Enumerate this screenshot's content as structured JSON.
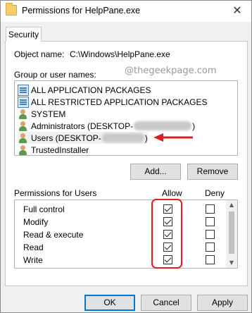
{
  "window": {
    "title": "Permissions for HelpPane.exe",
    "close_glyph": "✕",
    "folder_icon": "folder-icon"
  },
  "tabs": [
    {
      "label": "Security"
    }
  ],
  "object": {
    "label": "Object name:",
    "value": "C:\\Windows\\HelpPane.exe"
  },
  "groups": {
    "label": "Group or user names:",
    "watermark": "@thegeekpage.com",
    "items": [
      {
        "icon": "app-package-icon",
        "prefix": "ALL APPLICATION PACKAGES",
        "suffix": ""
      },
      {
        "icon": "app-package-icon",
        "prefix": "ALL RESTRICTED APPLICATION PACKAGES",
        "suffix": ""
      },
      {
        "icon": "users-icon",
        "prefix": "SYSTEM",
        "suffix": ""
      },
      {
        "icon": "users-icon",
        "prefix": "Administrators (DESKTOP-",
        "suffix": ")"
      },
      {
        "icon": "users-icon",
        "prefix": "Users (DESKTOP-",
        "suffix": ")"
      },
      {
        "icon": "users-icon",
        "prefix": "TrustedInstaller",
        "suffix": ""
      }
    ],
    "selected_index": 4,
    "annotation_arrow_color": "#e02020"
  },
  "buttons": {
    "add": "Add...",
    "remove": "Remove",
    "ok": "OK",
    "cancel": "Cancel",
    "apply": "Apply"
  },
  "permissions": {
    "label": "Permissions for Users",
    "allow_header": "Allow",
    "deny_header": "Deny",
    "rows": [
      {
        "name": "Full control",
        "allow": true,
        "deny": false
      },
      {
        "name": "Modify",
        "allow": true,
        "deny": false
      },
      {
        "name": "Read & execute",
        "allow": true,
        "deny": false
      },
      {
        "name": "Read",
        "allow": true,
        "deny": false
      },
      {
        "name": "Write",
        "allow": true,
        "deny": false
      }
    ],
    "highlight_color": "#e02020"
  },
  "colors": {
    "dialog_bg": "#f0f0f0",
    "panel_bg": "#ffffff",
    "default_button_border": "#0078d7"
  }
}
